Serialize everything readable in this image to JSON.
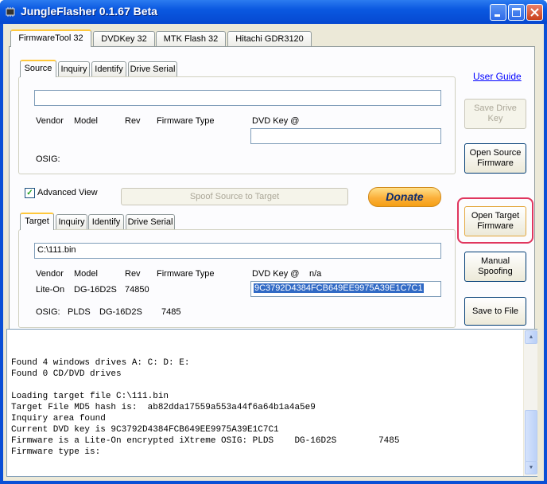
{
  "window": {
    "title": "JungleFlasher 0.1.67 Beta"
  },
  "main_tabs": [
    "FirmwareTool 32",
    "DVDKey 32",
    "MTK Flash 32",
    "Hitachi GDR3120"
  ],
  "source": {
    "tabs": [
      "Source",
      "Inquiry",
      "Identify",
      "Drive Serial"
    ],
    "path_value": "",
    "headers": {
      "vendor": "Vendor",
      "model": "Model",
      "rev": "Rev",
      "fw_type": "Firmware Type",
      "dvd_key": "DVD Key @"
    },
    "dvd_key_value": "",
    "osig_label": "OSIG:"
  },
  "advanced_view": {
    "label": "Advanced View",
    "checked": true
  },
  "spoof_button": "Spoof Source to Target",
  "donate_button": "Donate",
  "target": {
    "tabs": [
      "Target",
      "Inquiry",
      "Identify",
      "Drive Serial"
    ],
    "path_value": "C:\\111.bin",
    "headers": {
      "vendor": "Vendor",
      "model": "Model",
      "rev": "Rev",
      "fw_type": "Firmware Type",
      "dvd_key": "DVD Key @",
      "dvd_key_at": "n/a"
    },
    "vendor": "Lite-On",
    "model": "DG-16D2S",
    "rev": "74850",
    "dvd_key_value": "9C3792D4384FCB649EE9975A39E1C7C1",
    "osig_label": "OSIG:",
    "osig_vendor": "PLDS",
    "osig_model": "DG-16D2S",
    "osig_rev": "7485"
  },
  "right_panel": {
    "user_guide": "User Guide",
    "save_drive_key": [
      "Save Drive",
      "Key"
    ],
    "open_source_firmware": [
      "Open Source",
      "Firmware"
    ],
    "open_target_firmware": [
      "Open Target",
      "Firmware"
    ],
    "manual_spoofing": [
      "Manual",
      "Spoofing"
    ],
    "save_to_file": "Save to File"
  },
  "log": [
    "Found 4 windows drives A: C: D: E:",
    "Found 0 CD/DVD drives",
    "",
    "Loading target file C:\\111.bin",
    "Target File MD5 hash is:  ab82dda17559a553a44f6a64b1a4a5e9",
    "Inquiry area found",
    "Current DVD key is 9C3792D4384FCB649EE9975A39E1C7C1",
    "Firmware is a Lite-On encrypted iXtreme OSIG: PLDS    DG-16D2S        7485",
    "Firmware type is:"
  ],
  "colors": {
    "titlebar": "#0a58e0",
    "highlight_ring": "#e0365e",
    "donate": "#fbb03b",
    "selection": "#316ac5"
  },
  "icons": {
    "app": "chip-icon",
    "minimize": "minimize-icon",
    "maximize": "maximize-icon",
    "close": "close-icon",
    "scroll_up": "scroll-up-icon",
    "scroll_down": "scroll-down-icon"
  }
}
